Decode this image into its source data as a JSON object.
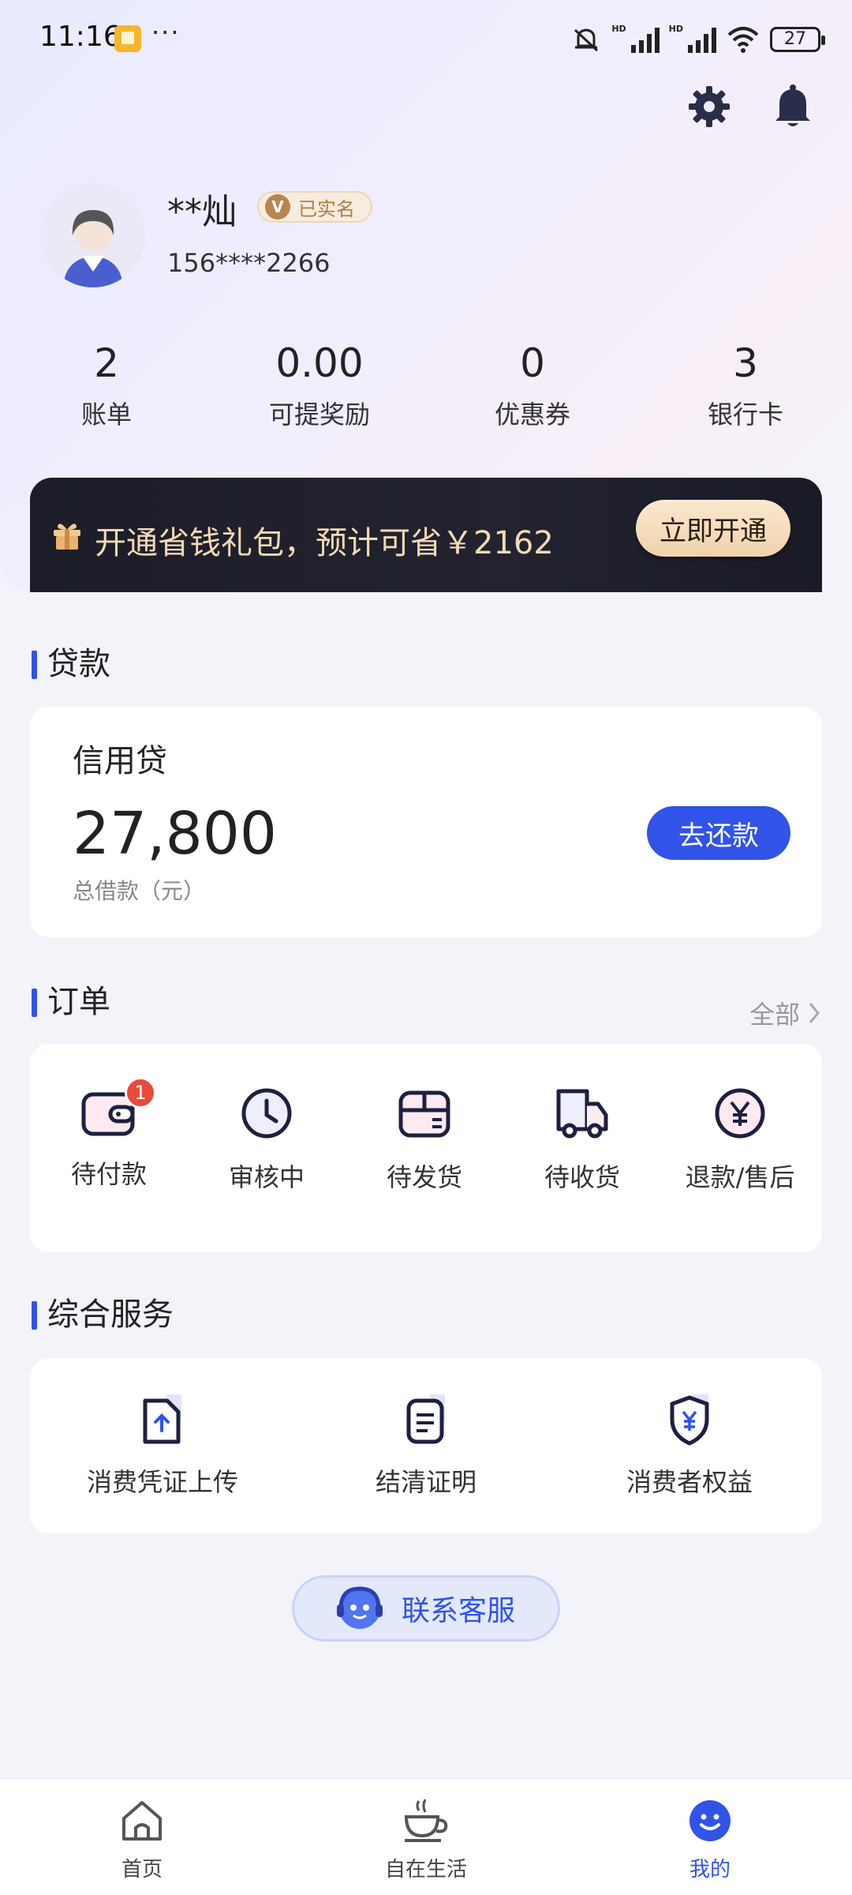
{
  "status_bar": {
    "time": "11:16",
    "more": "···",
    "hd1": "HD",
    "hd2": "HD",
    "battery": "27"
  },
  "profile": {
    "name": "**灿",
    "verified_label": "已实名",
    "verified_mark": "V",
    "phone": "156****2266"
  },
  "stats": [
    {
      "value": "2",
      "label": "账单"
    },
    {
      "value": "0.00",
      "label": "可提奖励"
    },
    {
      "value": "0",
      "label": "优惠券"
    },
    {
      "value": "3",
      "label": "银行卡"
    }
  ],
  "promo": {
    "text": "开通省钱礼包，预计可省￥2162",
    "button": "立即开通"
  },
  "loan": {
    "section_title": "贷款",
    "product_name": "信用贷",
    "amount": "27,800",
    "amount_label": "总借款（元）",
    "repay_button": "去还款"
  },
  "orders": {
    "section_title": "订单",
    "all_link": "全部",
    "items": [
      {
        "label": "待付款",
        "badge": "1",
        "icon": "wallet-icon"
      },
      {
        "label": "审核中",
        "icon": "clock-icon"
      },
      {
        "label": "待发货",
        "icon": "package-icon"
      },
      {
        "label": "待收货",
        "icon": "truck-icon"
      },
      {
        "label": "退款/售后",
        "icon": "refund-icon"
      }
    ]
  },
  "services": {
    "section_title": "综合服务",
    "items": [
      {
        "label": "消费凭证上传",
        "icon": "upload-doc-icon"
      },
      {
        "label": "结清证明",
        "icon": "certificate-icon"
      },
      {
        "label": "消费者权益",
        "icon": "shield-yuan-icon"
      }
    ]
  },
  "customer_service": {
    "label": "联系客服"
  },
  "tabbar": {
    "items": [
      {
        "label": "首页",
        "icon": "home-icon"
      },
      {
        "label": "自在生活",
        "icon": "coffee-icon"
      },
      {
        "label": "我的",
        "icon": "smiley-icon",
        "active": true
      }
    ]
  },
  "colors": {
    "accent": "#3153e8",
    "badge": "#e84a3c",
    "promo_bg": "#1c1d28",
    "promo_text": "#f3d9b6"
  }
}
